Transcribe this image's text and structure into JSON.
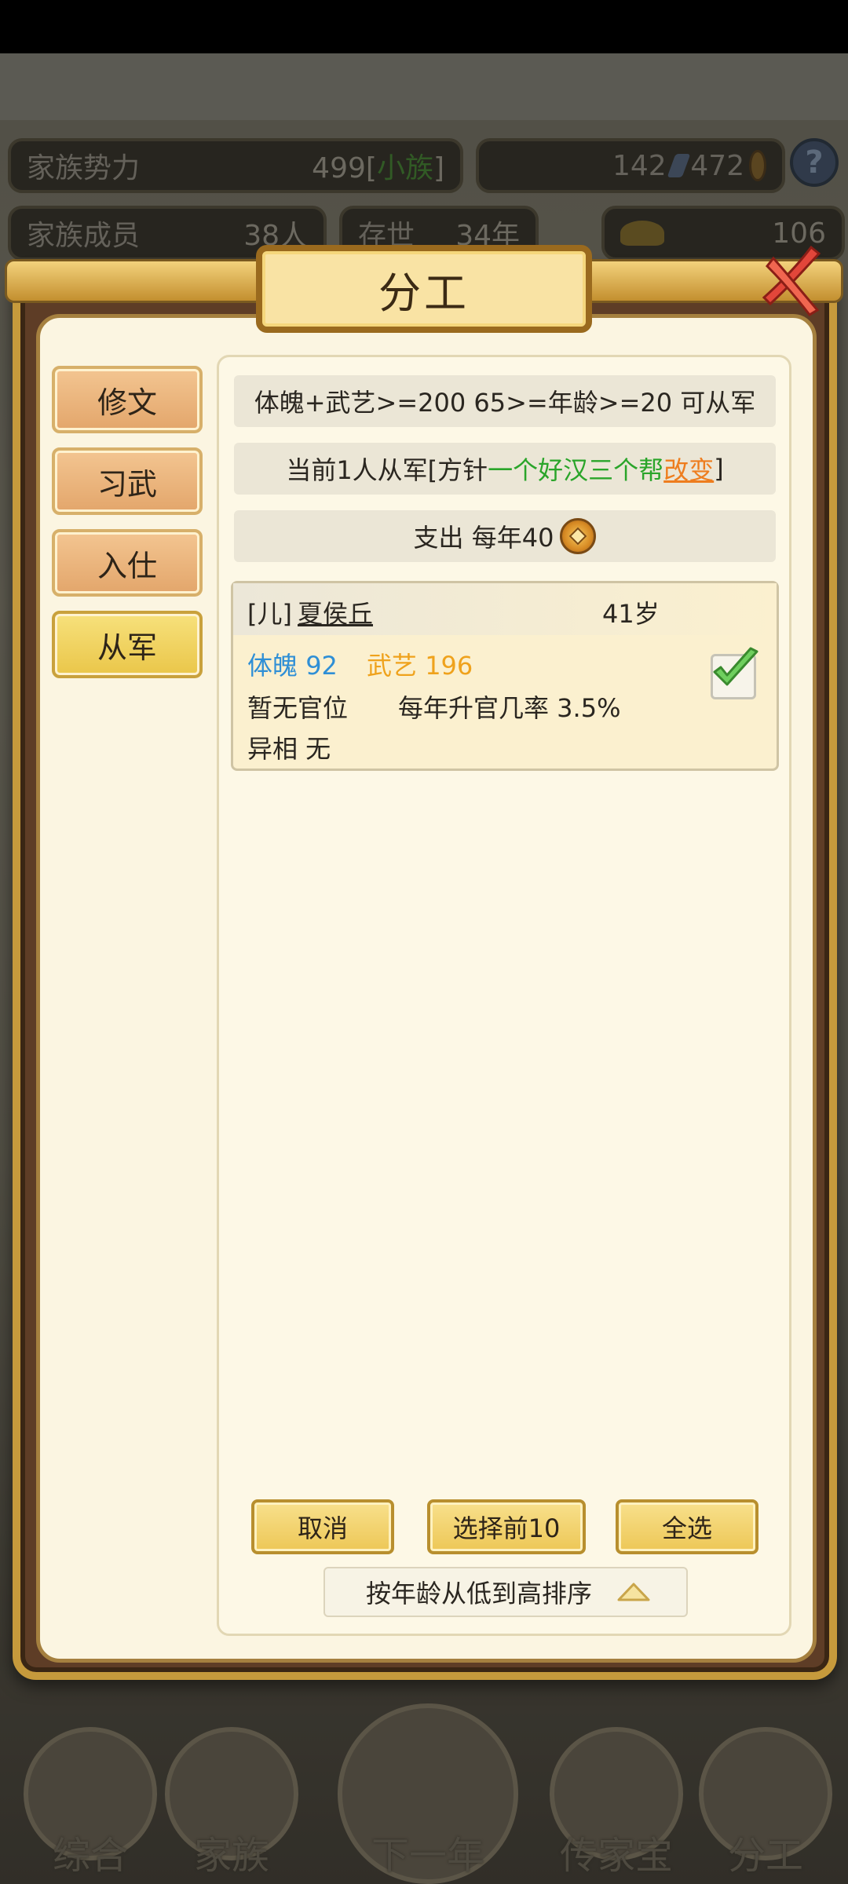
{
  "top_stats": {
    "family_power_label": "家族势力",
    "family_power_value": "499[",
    "family_power_rank": "小族",
    "family_power_close": "]",
    "currency_a": "142",
    "currency_b": "472",
    "members_label": "家族成员",
    "members_value": "38人",
    "existence_label": "存世",
    "existence_value": "34年",
    "gold_value": "106",
    "help_label": "?"
  },
  "dialog": {
    "title": "分工",
    "tabs": [
      {
        "label": "修文",
        "active": false
      },
      {
        "label": "习武",
        "active": false
      },
      {
        "label": "入仕",
        "active": false
      },
      {
        "label": "从军",
        "active": true
      }
    ],
    "requirement": "体魄+武艺>=200 65>=年龄>=20 可从军",
    "policy_prefix": "当前1人从军[方针",
    "policy_name": "一个好汉三个帮",
    "policy_change": "改变",
    "policy_suffix": "]",
    "expense": "支出 每年40",
    "member": {
      "relation": "[儿]",
      "name": "夏侯丘",
      "age": "41岁",
      "physique_label": "体魄",
      "physique_value": "92",
      "martial_label": "武艺",
      "martial_value": "196",
      "office": "暂无官位",
      "promotion": "每年升官几率 3.5%",
      "trait": "异相 无",
      "selected": true
    },
    "buttons": {
      "cancel": "取消",
      "select_top10": "选择前10",
      "select_all": "全选"
    },
    "sort_label": "按年龄从低到高排序"
  },
  "bottom_nav": [
    "综合",
    "家族",
    "下一年",
    "传家宝",
    "分工"
  ],
  "colors": {
    "accent_gold": "#edc756",
    "green_text": "#2aa52a",
    "orange_link": "#ee7d1e",
    "blue_stat": "#2f8fd6",
    "gold_stat": "#efa21c"
  }
}
